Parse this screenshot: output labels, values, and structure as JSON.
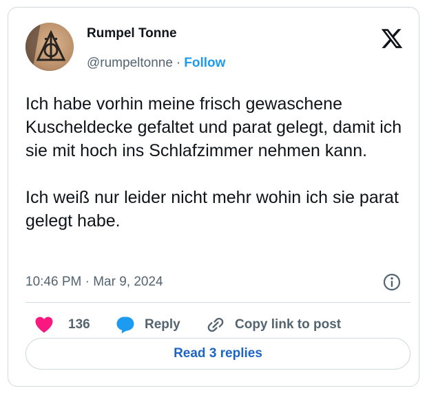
{
  "author": {
    "name": "Rumpel Tonne",
    "handle": "@rumpeltonne",
    "separator": "·",
    "follow_label": "Follow",
    "avatar_icon": "deathly-hallows-symbol"
  },
  "platform": {
    "logo_icon": "x-logo"
  },
  "tweet": {
    "paragraph_1": "Ich habe vorhin meine frisch gewaschene Kuscheldecke gefaltet und parat gelegt, damit ich sie mit hoch ins Schlafzimmer nehmen kann.",
    "paragraph_2": "Ich weiß nur leider nicht mehr wohin ich sie parat gelegt habe.",
    "timestamp": "10:46 PM · Mar 9, 2024"
  },
  "actions": {
    "like_count": "136",
    "reply_label": "Reply",
    "copy_link_label": "Copy link to post",
    "read_replies_label": "Read 3 replies"
  },
  "colors": {
    "like_heart": "#f91880",
    "reply_bubble": "#1d9bf0",
    "follow_link": "#1d9bf0",
    "read_replies_text": "#1d64c4",
    "border": "#cfd9de",
    "secondary_text": "#536471"
  }
}
